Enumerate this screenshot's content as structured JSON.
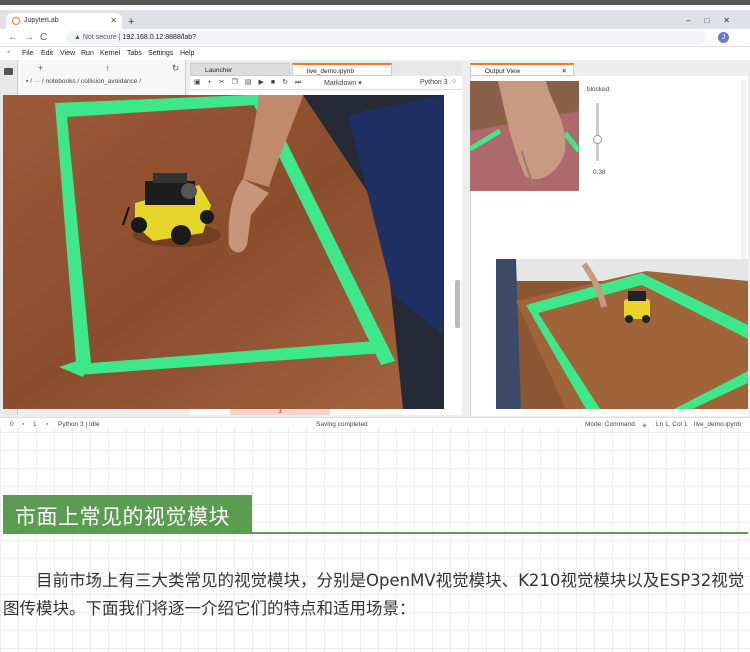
{
  "browser": {
    "tab_title": "JupyterLab",
    "new_tab": "+",
    "window_controls": [
      "–",
      "□",
      "✕"
    ],
    "nav_icons": [
      "←",
      "→",
      "C"
    ],
    "security": "Not secure",
    "url": "192.168.0.12:8888/lab?",
    "profile_initial": "J"
  },
  "jupyter": {
    "menu": [
      "File",
      "Edit",
      "View",
      "Run",
      "Kernel",
      "Tabs",
      "Settings",
      "Help"
    ],
    "breadcrumb": "/ notebooks / collision_avoidance /",
    "tabs": [
      "Launcher",
      "live_demo.ipynb"
    ],
    "cell_type": "Markdown",
    "kernel": "Python 3",
    "output_tab": "Output View",
    "slider_label": "blocked",
    "slider_value": "0.38",
    "slider_fraction": 0.38,
    "cell_counter": "3",
    "status": {
      "left_a": "0",
      "left_b": "1",
      "kernel_state": "Python 3 | Idle",
      "center": "Saving completed",
      "mode": "Mode: Command",
      "cursor": "Ln 1, Col 1",
      "file": "live_demo.ipynb"
    }
  },
  "article": {
    "heading": "市面上常见的视觉模块",
    "paragraph": "目前市场上有三大类常见的视觉模块，分别是OpenMV视觉模块、K210视觉模块以及ESP32视觉图传模块。下面我们将逐一介绍它们的特点和适用场景："
  },
  "colors": {
    "heading_bg": "#5b9b52",
    "jupyter_orange": "#f37726",
    "tape_green": "#3ee88a",
    "table_wood": "#8a5132",
    "robot_yellow": "#e6d629"
  }
}
